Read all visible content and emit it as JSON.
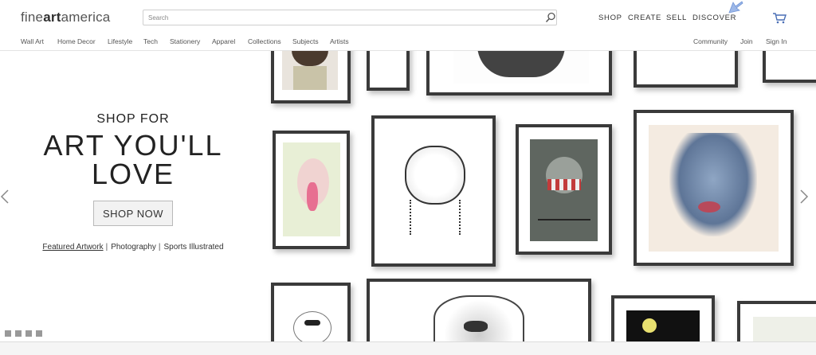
{
  "header": {
    "logo_prefix": "fine",
    "logo_bold": "art",
    "logo_suffix": "america",
    "search": {
      "placeholder": "Search",
      "value": ""
    },
    "top_nav": [
      "SHOP",
      "CREATE",
      "SELL",
      "DISCOVER"
    ],
    "sub_nav_left": [
      "Wall Art",
      "Home Decor",
      "Lifestyle",
      "Tech",
      "Stationery",
      "Apparel",
      "Collections",
      "Subjects",
      "Artists"
    ],
    "sub_nav_right": [
      "Community",
      "Join",
      "Sign In"
    ]
  },
  "hero": {
    "eyebrow": "SHOP FOR",
    "headline_line1": "ART YOU'LL",
    "headline_line2": "LOVE",
    "cta_label": "SHOP NOW",
    "links": [
      "Featured Artwork",
      "Photography",
      "Sports Illustrated"
    ],
    "link_separator": "|",
    "slide_count": 4
  },
  "colors": {
    "frame": "#3a3a3a",
    "logo_text": "#555555",
    "button_bg": "#f2f2f2",
    "dot": "#999999"
  },
  "icons": {
    "search": "search-icon",
    "cart": "cart-icon",
    "prev": "chevron-left-icon",
    "next": "chevron-right-icon"
  }
}
